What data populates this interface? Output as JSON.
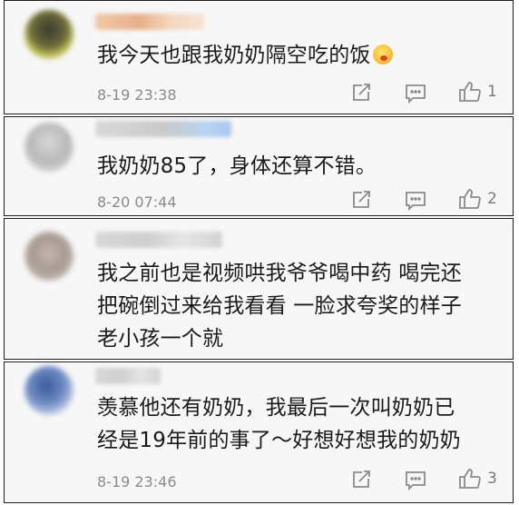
{
  "comments": [
    {
      "text": "我今天也跟我奶奶隔空吃的饭",
      "emoji": "face-with-tongue-emoji",
      "time": "8-19 23:38",
      "likes": "1"
    },
    {
      "text": "我奶奶85了，身体还算不错。",
      "time": "8-20 07:44",
      "likes": "2"
    },
    {
      "lines": [
        "我之前也是视频哄我爷爷喝中药  喝完还",
        "把碗倒过来给我看看  一脸求夸奖的样子",
        "老小孩一个就"
      ]
    },
    {
      "lines": [
        "羡慕他还有奶奶，我最后一次叫奶奶已",
        "经是19年前的事了～好想好想我的奶奶"
      ],
      "time": "8-19 23:46",
      "likes": "3"
    }
  ],
  "icons": {
    "share": "share-icon",
    "comment": "comment-icon",
    "like": "thumbs-up-icon"
  }
}
